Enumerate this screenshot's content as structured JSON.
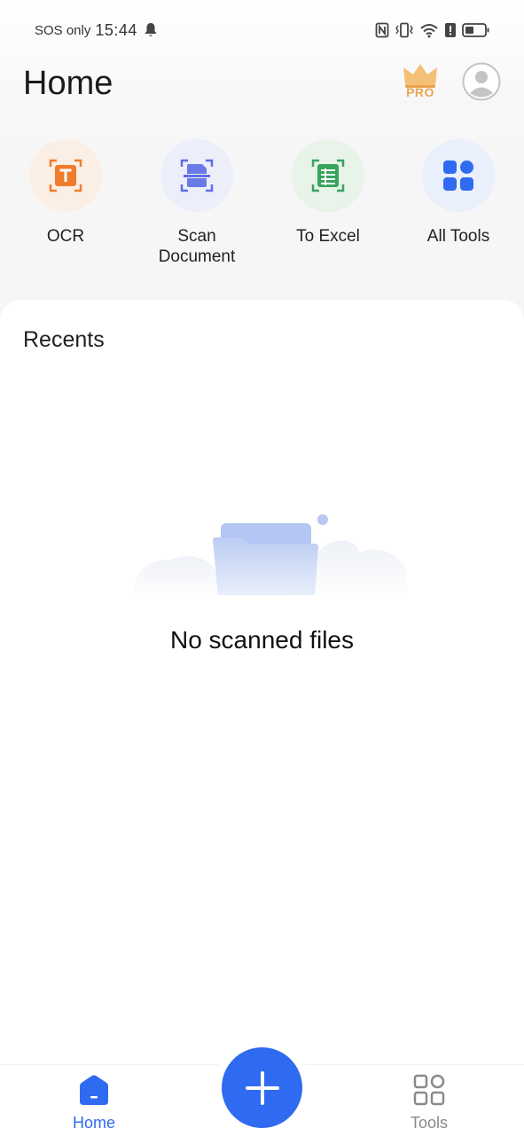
{
  "status_bar": {
    "carrier": "SOS only",
    "time": "15:44"
  },
  "header": {
    "title": "Home",
    "pro_label": "PRO"
  },
  "tools": [
    {
      "label": "OCR",
      "icon": "ocr-icon",
      "color": "#ef7d2e",
      "bg": "#fbeee4"
    },
    {
      "label": "Scan\nDocument",
      "icon": "scan-document-icon",
      "color": "#5d6ee8",
      "bg": "#eceffa"
    },
    {
      "label": "To Excel",
      "icon": "excel-icon",
      "color": "#3aa35c",
      "bg": "#e8f3ea"
    },
    {
      "label": "All Tools",
      "icon": "all-tools-icon",
      "color": "#2f6bf0",
      "bg": "#e9effb"
    }
  ],
  "recents": {
    "title": "Recents",
    "empty_message": "No scanned files"
  },
  "bottom_nav": {
    "home_label": "Home",
    "tools_label": "Tools",
    "active_color": "#2f6bf0",
    "inactive_color": "#8a8a8a"
  }
}
